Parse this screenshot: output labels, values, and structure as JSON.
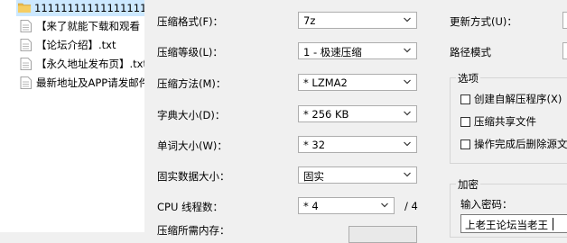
{
  "files": [
    {
      "name": "1111111111111111111",
      "type": "folder",
      "selected": true
    },
    {
      "name": "【来了就能下载和观看",
      "type": "file"
    },
    {
      "name": "【论坛介绍】.txt",
      "type": "file"
    },
    {
      "name": "【永久地址发布页】.txt",
      "type": "file"
    },
    {
      "name": "最新地址及APP请发邮件",
      "type": "file"
    }
  ],
  "settings": {
    "archive_format": {
      "label": "压缩格式(F)：",
      "value": "7z"
    },
    "compression_level": {
      "label": "压缩等级(L)：",
      "value": "1 - 极速压缩"
    },
    "compression_method": {
      "label": "压缩方法(M)：",
      "value": "* LZMA2"
    },
    "dictionary_size": {
      "label": "字典大小(D)：",
      "value": "* 256 KB"
    },
    "word_size": {
      "label": "单词大小(W)：",
      "value": "* 32"
    },
    "solid_block_size": {
      "label": "固实数据大小：",
      "value": "固实"
    },
    "cpu_threads": {
      "label": "CPU 线程数：",
      "value": "* 4",
      "max": "/ 4"
    },
    "memory_usage": {
      "label": "压缩所需内存："
    }
  },
  "right": {
    "update_mode_label": "更新方式(U)：",
    "path_mode_label": "路径模式",
    "options": {
      "title": "选项",
      "items": [
        {
          "label": "创建自解压程序(X)",
          "checked": false
        },
        {
          "label": "压缩共享文件",
          "checked": false
        },
        {
          "label": "操作完成后删除源文件",
          "checked": false
        }
      ]
    },
    "encryption": {
      "title": "加密",
      "password_label": "输入密码：",
      "password_value": "上老王论坛当老王"
    }
  },
  "colors": {
    "selection": "#cce8ff",
    "background": "#f0f0f0"
  }
}
